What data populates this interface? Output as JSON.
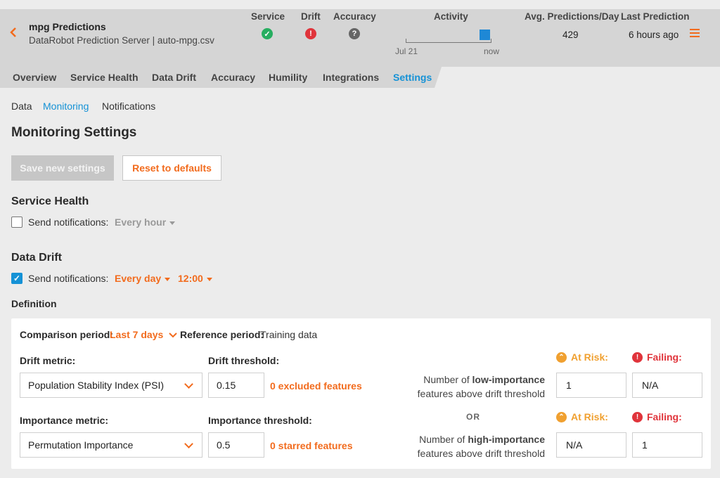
{
  "header": {
    "title": "mpg Predictions",
    "subtitle": "DataRobot Prediction Server | auto-mpg.csv",
    "service_label": "Service",
    "drift_label": "Drift",
    "accuracy_label": "Accuracy",
    "activity_label": "Activity",
    "activity_start": "Jul 21",
    "activity_end": "now",
    "avg_predictions_label": "Avg. Predictions/Day",
    "avg_predictions_value": "429",
    "last_prediction_label": "Last Prediction",
    "last_prediction_value": "6 hours ago",
    "status_colors": {
      "service": "#27ae60",
      "drift": "#e0343b",
      "accuracy": "#666666"
    }
  },
  "tabs": [
    "Overview",
    "Service Health",
    "Data Drift",
    "Accuracy",
    "Humility",
    "Integrations",
    "Settings"
  ],
  "subnav": [
    "Data",
    "Monitoring",
    "Notifications"
  ],
  "page_title": "Monitoring Settings",
  "buttons": {
    "save": "Save new settings",
    "reset": "Reset to defaults"
  },
  "service_health": {
    "title": "Service Health",
    "send_label": "Send notifications:",
    "frequency": "Every hour",
    "checked": false
  },
  "data_drift": {
    "title": "Data Drift",
    "send_label": "Send notifications:",
    "frequency": "Every day",
    "time": "12:00",
    "checked": true
  },
  "definition": {
    "label": "Definition",
    "comparison_label": "Comparison period:",
    "comparison_value": "Last 7 days",
    "reference_label": "Reference period:",
    "reference_value": "Training data",
    "drift_metric_label": "Drift metric:",
    "drift_metric_value": "Population Stability Index (PSI)",
    "drift_threshold_label": "Drift threshold:",
    "drift_threshold_value": "0.15",
    "excluded_features": "0 excluded features",
    "importance_metric_label": "Importance metric:",
    "importance_metric_value": "Permutation Importance",
    "importance_threshold_label": "Importance threshold:",
    "importance_threshold_value": "0.5",
    "starred_features": "0 starred features",
    "at_risk_label": "At Risk:",
    "failing_label": "Failing:",
    "low_desc_prefix": "Number of ",
    "low_desc_bold": "low-importance",
    "low_desc_suffix": "features above drift threshold",
    "low_at_risk": "1",
    "low_failing": "N/A",
    "or_label": "OR",
    "high_desc_prefix": "Number of ",
    "high_desc_bold": "high-importance",
    "high_desc_suffix": "features above drift threshold",
    "high_at_risk": "N/A",
    "high_failing": "1"
  }
}
